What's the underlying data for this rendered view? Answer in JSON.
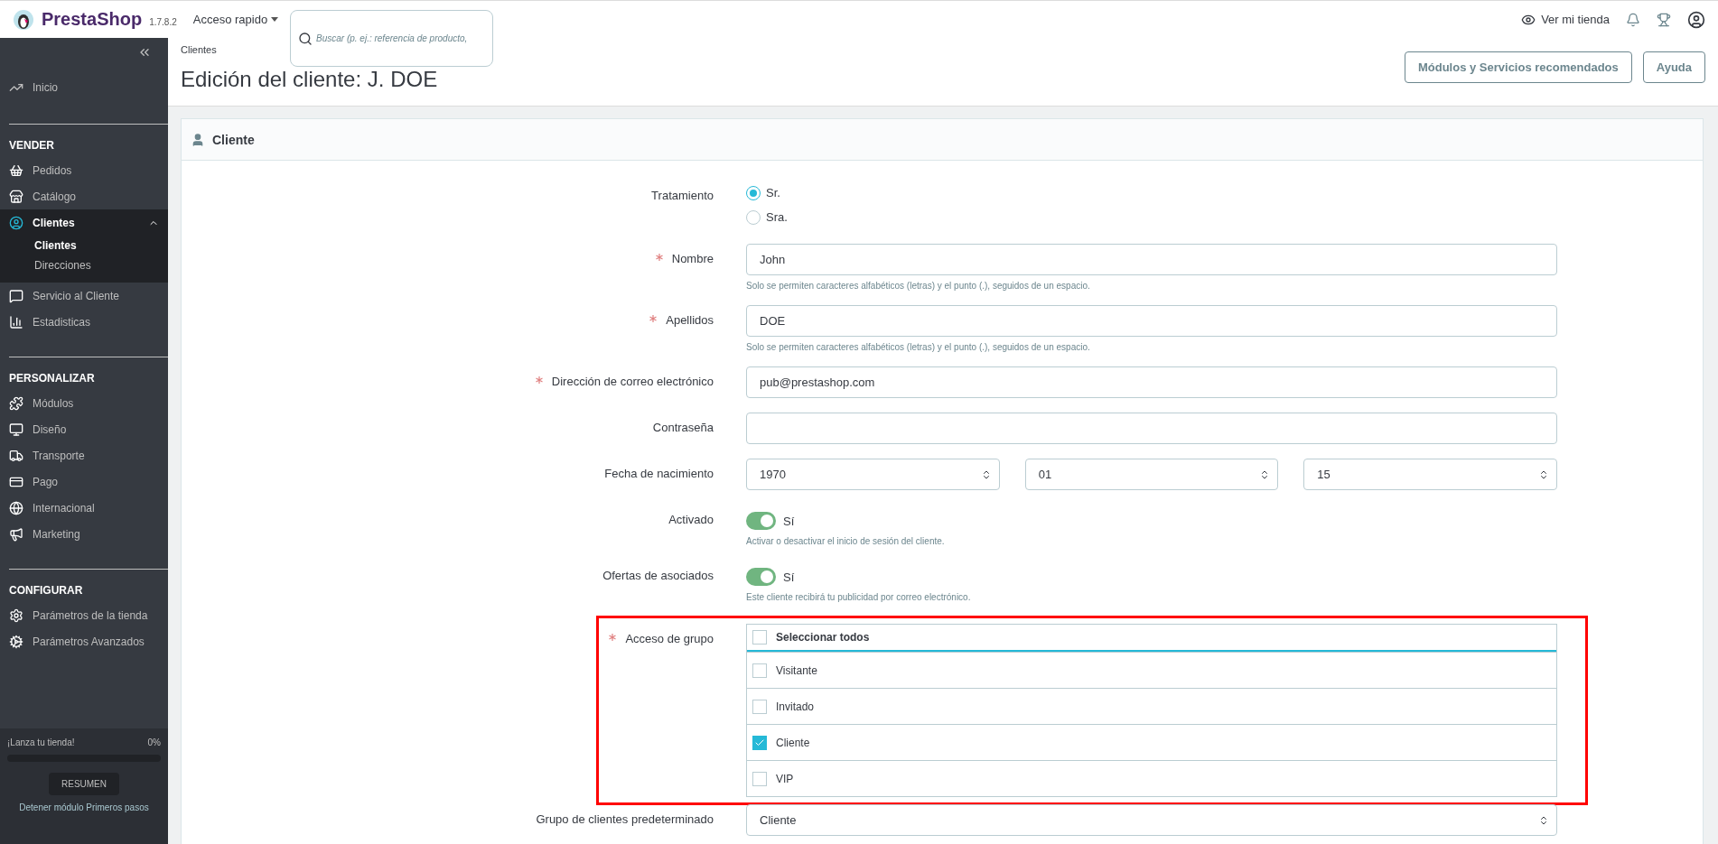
{
  "topbar": {
    "brand": "PrestaShop",
    "version": "1.7.8.2",
    "quick_access": "Acceso rapido",
    "search": {
      "placeholder": "Buscar (p. ej.: referencia de producto,"
    },
    "view_store": "Ver mi tienda"
  },
  "sidebar": {
    "home": "Inicio",
    "sections": [
      {
        "title": "VENDER",
        "items": [
          {
            "label": "Pedidos",
            "expanded": false,
            "selected": false
          },
          {
            "label": "Catálogo",
            "expanded": false,
            "selected": false
          },
          {
            "label": "Clientes",
            "expanded": true,
            "selected": true,
            "children": [
              {
                "label": "Clientes",
                "selected": true
              },
              {
                "label": "Direcciones",
                "selected": false
              }
            ]
          },
          {
            "label": "Servicio al Cliente",
            "expanded": false,
            "selected": false
          },
          {
            "label": "Estadisticas",
            "expanded": false,
            "selected": false
          }
        ]
      },
      {
        "title": "PERSONALIZAR",
        "items": [
          {
            "label": "Módulos",
            "expanded": false,
            "selected": false
          },
          {
            "label": "Diseño",
            "expanded": false,
            "selected": false
          },
          {
            "label": "Transporte",
            "expanded": false,
            "selected": false
          },
          {
            "label": "Pago",
            "expanded": false,
            "selected": false
          },
          {
            "label": "Internacional",
            "expanded": false,
            "selected": false
          },
          {
            "label": "Marketing",
            "expanded": false,
            "selected": false
          }
        ]
      },
      {
        "title": "CONFIGURAR",
        "items": [
          {
            "label": "Parámetros de la tienda",
            "expanded": false,
            "selected": false
          },
          {
            "label": "Parámetros Avanzados",
            "expanded": false,
            "selected": false
          }
        ]
      }
    ],
    "onboarding": {
      "title": "¡Lanza tu tienda!",
      "percent": "0%",
      "level": 0,
      "button": "RESUMEN",
      "stop_link": "Detener módulo Primeros pasos"
    }
  },
  "header": {
    "breadcrumb": "Clientes",
    "title": "Edición del cliente: J. DOE",
    "buttons": [
      "Módulos y Servicios recomendados",
      "Ayuda"
    ]
  },
  "card": {
    "title": "Cliente",
    "fields": [
      {
        "kind": "radio",
        "label": "Tratamiento",
        "required": false,
        "options": [
          {
            "label": "Sr.",
            "selected": true
          },
          {
            "label": "Sra.",
            "selected": false
          }
        ]
      },
      {
        "kind": "text",
        "label": "Nombre",
        "required": true,
        "value": "John",
        "hint": "Solo se permiten caracteres alfabéticos (letras) y el punto (.), seguidos de un espacio."
      },
      {
        "kind": "text",
        "label": "Apellidos",
        "required": true,
        "value": "DOE",
        "hint": "Solo se permiten caracteres alfabéticos (letras) y el punto (.), seguidos de un espacio."
      },
      {
        "kind": "text",
        "label": "Dirección de correo electrónico",
        "required": true,
        "value": "pub@prestashop.com"
      },
      {
        "kind": "password",
        "label": "Contraseña",
        "required": false
      },
      {
        "kind": "date",
        "label": "Fecha de nacimiento",
        "required": false,
        "selects": [
          "1970",
          "01",
          "15"
        ]
      },
      {
        "kind": "switch",
        "label": "Activado",
        "required": false,
        "on": true,
        "text": "Sí",
        "hint": "Activar o desactivar el inicio de sesión del cliente."
      },
      {
        "kind": "switch",
        "label": "Ofertas de asociados",
        "required": false,
        "on": true,
        "text": "Sí",
        "hint": "Este cliente recibirá tu publicidad por correo electrónico."
      },
      {
        "kind": "checkgroup",
        "label": "Acceso de grupo",
        "required": true,
        "highlighted": true,
        "select_all": {
          "label": "Seleccionar todos",
          "checked": false
        },
        "options": [
          {
            "label": "Visitante",
            "checked": false
          },
          {
            "label": "Invitado",
            "checked": false
          },
          {
            "label": "Cliente",
            "checked": true
          },
          {
            "label": "VIP",
            "checked": false
          }
        ]
      },
      {
        "kind": "select",
        "label": "Grupo de clientes predeterminado",
        "required": false,
        "value": "Cliente"
      }
    ]
  }
}
